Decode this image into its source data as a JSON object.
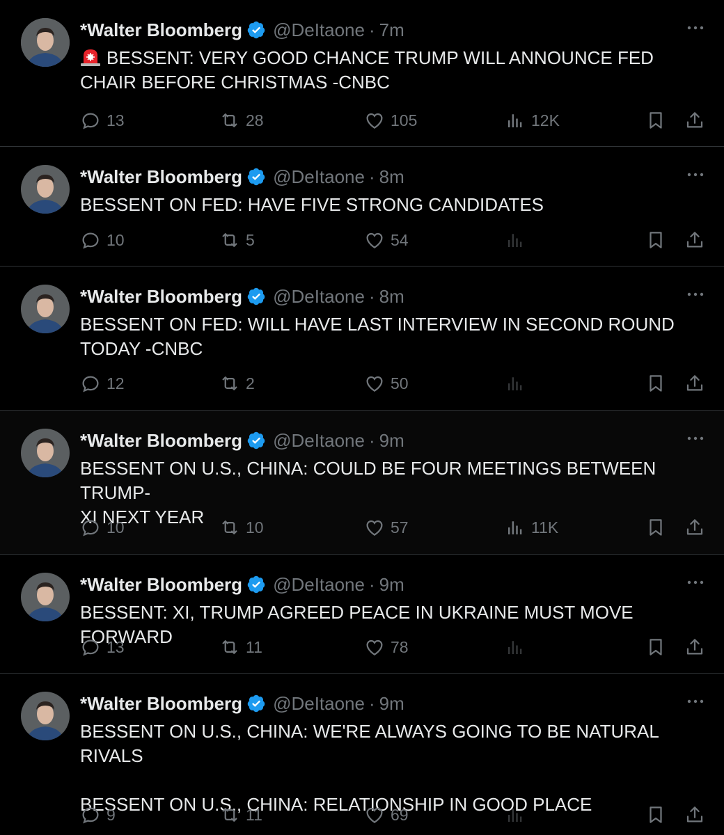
{
  "author": {
    "name": "*Walter Bloomberg",
    "handle": "@DeItaone",
    "verified_color": "#1d9bf0"
  },
  "icons": {
    "reply": "reply-icon",
    "retweet": "retweet-icon",
    "like": "like-icon",
    "views": "views-icon",
    "bookmark": "bookmark-icon",
    "share": "share-icon",
    "more": "more-icon",
    "verified": "verified-badge-icon",
    "siren": "siren-emoji-icon"
  },
  "tweets": [
    {
      "time": "7m",
      "has_siren": true,
      "text": "BESSENT: VERY GOOD CHANCE TRUMP WILL ANNOUNCE FED CHAIR BEFORE CHRISTMAS -CNBC",
      "replies": "13",
      "retweets": "28",
      "likes": "105",
      "views": "12K"
    },
    {
      "time": "8m",
      "has_siren": false,
      "text": "BESSENT ON FED: HAVE FIVE STRONG CANDIDATES",
      "replies": "10",
      "retweets": "5",
      "likes": "54",
      "views": ""
    },
    {
      "time": "8m",
      "has_siren": false,
      "text": "BESSENT ON FED: WILL HAVE LAST INTERVIEW IN SECOND ROUND\nTODAY -CNBC",
      "replies": "12",
      "retweets": "2",
      "likes": "50",
      "views": ""
    },
    {
      "time": "9m",
      "has_siren": false,
      "text": "BESSENT ON U.S., CHINA: COULD BE FOUR MEETINGS BETWEEN TRUMP-\nXI NEXT YEAR",
      "replies": "10",
      "retweets": "10",
      "likes": "57",
      "views": "11K"
    },
    {
      "time": "9m",
      "has_siren": false,
      "text": "BESSENT: XI, TRUMP AGREED PEACE IN UKRAINE MUST MOVE FORWARD",
      "replies": "13",
      "retweets": "11",
      "likes": "78",
      "views": ""
    },
    {
      "time": "9m",
      "has_siren": false,
      "text": "BESSENT ON U.S., CHINA: WE'RE ALWAYS GOING TO BE NATURAL RIVALS\n\nBESSENT ON U.S., CHINA: RELATIONSHIP IN GOOD PLACE",
      "replies": "9",
      "retweets": "11",
      "likes": "69",
      "views": ""
    }
  ]
}
